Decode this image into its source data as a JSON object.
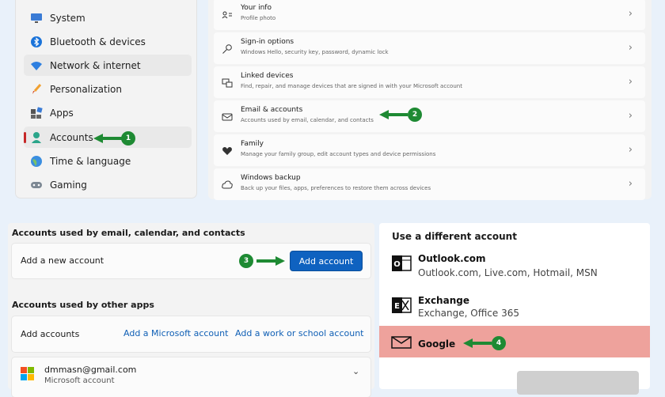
{
  "sidebar": {
    "items": [
      {
        "label": "System",
        "icon": "monitor-icon"
      },
      {
        "label": "Bluetooth & devices",
        "icon": "bluetooth-icon"
      },
      {
        "label": "Network & internet",
        "icon": "wifi-icon"
      },
      {
        "label": "Personalization",
        "icon": "brush-icon"
      },
      {
        "label": "Apps",
        "icon": "apps-icon"
      },
      {
        "label": "Accounts",
        "icon": "person-icon"
      },
      {
        "label": "Time & language",
        "icon": "globe-icon"
      },
      {
        "label": "Gaming",
        "icon": "gamepad-icon"
      }
    ],
    "selected": "Accounts"
  },
  "settings_list": {
    "rows": [
      {
        "title": "Your info",
        "subtitle": "Profile photo",
        "icon": "person-card-icon"
      },
      {
        "title": "Sign-in options",
        "subtitle": "Windows Hello, security key, password, dynamic lock",
        "icon": "key-icon"
      },
      {
        "title": "Linked devices",
        "subtitle": "Find, repair, and manage devices that are signed in with your Microsoft account",
        "icon": "devices-icon"
      },
      {
        "title": "Email & accounts",
        "subtitle": "Accounts used by email, calendar, and contacts",
        "icon": "mail-icon"
      },
      {
        "title": "Family",
        "subtitle": "Manage your family group, edit account types and device permissions",
        "icon": "heart-icon"
      },
      {
        "title": "Windows backup",
        "subtitle": "Back up your files, apps, preferences to restore them across devices",
        "icon": "backup-icon"
      }
    ]
  },
  "email_accounts": {
    "section1_title": "Accounts used by email, calendar, and contacts",
    "add_new_label": "Add a new account",
    "add_account_button": "Add account",
    "section2_title": "Accounts used by other apps",
    "add_accounts_label": "Add accounts",
    "add_microsoft_link": "Add a Microsoft account",
    "add_work_link": "Add a work or school account",
    "account_email": "dmmasn@gmail.com",
    "account_sub": "Microsoft account"
  },
  "different_account": {
    "title": "Use a different account",
    "options": [
      {
        "name": "Outlook.com",
        "desc": "Outlook.com, Live.com, Hotmail, MSN"
      },
      {
        "name": "Exchange",
        "desc": "Exchange, Office 365"
      },
      {
        "name": "Google",
        "desc": ""
      }
    ],
    "highlight_color": "#eea29c"
  },
  "callouts": [
    "1",
    "2",
    "3",
    "4"
  ],
  "colors": {
    "accent": "#0f62c0",
    "callout": "#1e8a33",
    "selection": "#c62828"
  }
}
